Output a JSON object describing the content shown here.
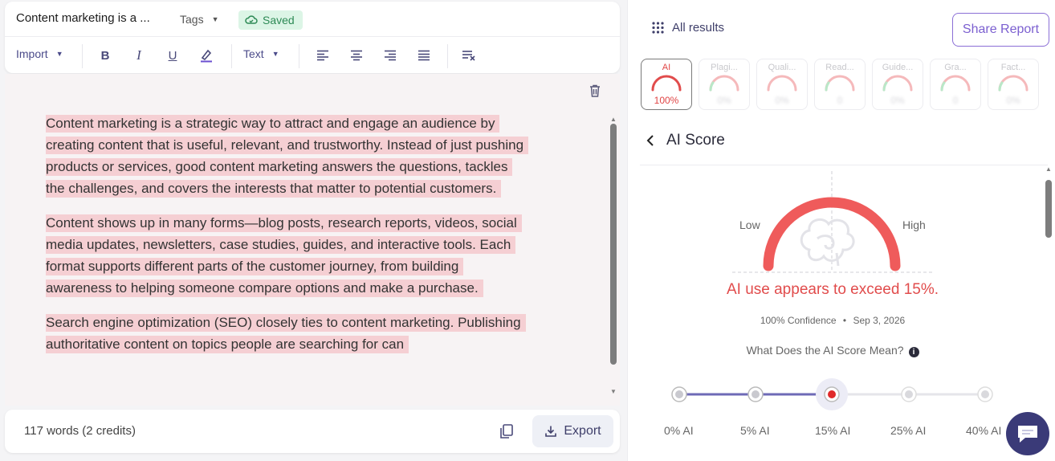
{
  "editor": {
    "doc_title": "Content marketing is a ...",
    "tags_label": "Tags",
    "saved_label": "Saved",
    "toolbar": {
      "import_label": "Import",
      "bold": "B",
      "italic": "I",
      "underline": "U",
      "text_style_label": "Text"
    },
    "paragraphs": [
      "Content marketing is a strategic way to attract and engage an audience by creating content that is useful, relevant, and trustworthy. Instead of just pushing products or services, good content marketing answers the questions, tackles the challenges, and covers the interests that matter to potential customers.",
      "Content shows up in many forms—blog posts, research reports, videos, social media updates, newsletters, case studies, guides, and interactive tools. Each format supports different parts of the customer journey, from building awareness to helping someone compare options and make a purchase.",
      "Search engine optimization (SEO) closely ties to content marketing. Publishing authoritative content on topics people are searching for can"
    ],
    "word_count": "117 words (2 credits)",
    "export_label": "Export"
  },
  "panel": {
    "all_results_label": "All results",
    "share_label": "Share Report",
    "tiles": [
      {
        "name": "AI",
        "value": "100%",
        "active": true
      },
      {
        "name": "Plagi...",
        "value": "0%",
        "active": false
      },
      {
        "name": "Quali...",
        "value": "0%",
        "active": false
      },
      {
        "name": "Read...",
        "value": "0",
        "active": false
      },
      {
        "name": "Guide...",
        "value": "0%",
        "active": false
      },
      {
        "name": "Gra...",
        "value": "0",
        "active": false
      },
      {
        "name": "Fact...",
        "value": "0%",
        "active": false
      }
    ],
    "score_title": "AI Score",
    "gauge": {
      "low_label": "Low",
      "high_label": "High",
      "result_text": "AI use appears to exceed 15%.",
      "confidence": "100% Confidence",
      "date": "Sep 3, 2026",
      "meaning_label": "What Does the AI Score Mean?"
    },
    "scale": [
      {
        "label": "0% AI"
      },
      {
        "label": "5% AI"
      },
      {
        "label": "15% AI"
      },
      {
        "label": "25% AI"
      },
      {
        "label": "40% AI"
      }
    ],
    "selected_scale_index": 2
  },
  "colors": {
    "accent": "#7b5fd0",
    "danger": "#e14c4c",
    "highlight": "#f5cfd3",
    "saved_bg": "#dcf5e6",
    "saved_text": "#2d8a55",
    "chat_bg": "#3a3a78"
  },
  "icons": [
    "cloud-check-icon",
    "highlighter-icon",
    "align-left-icon",
    "align-center-icon",
    "align-right-icon",
    "align-justify-icon",
    "clear-format-icon",
    "trash-icon",
    "copy-icon",
    "download-icon",
    "grid-icon",
    "chevron-left-icon",
    "brain-icon",
    "info-icon",
    "chat-icon"
  ]
}
